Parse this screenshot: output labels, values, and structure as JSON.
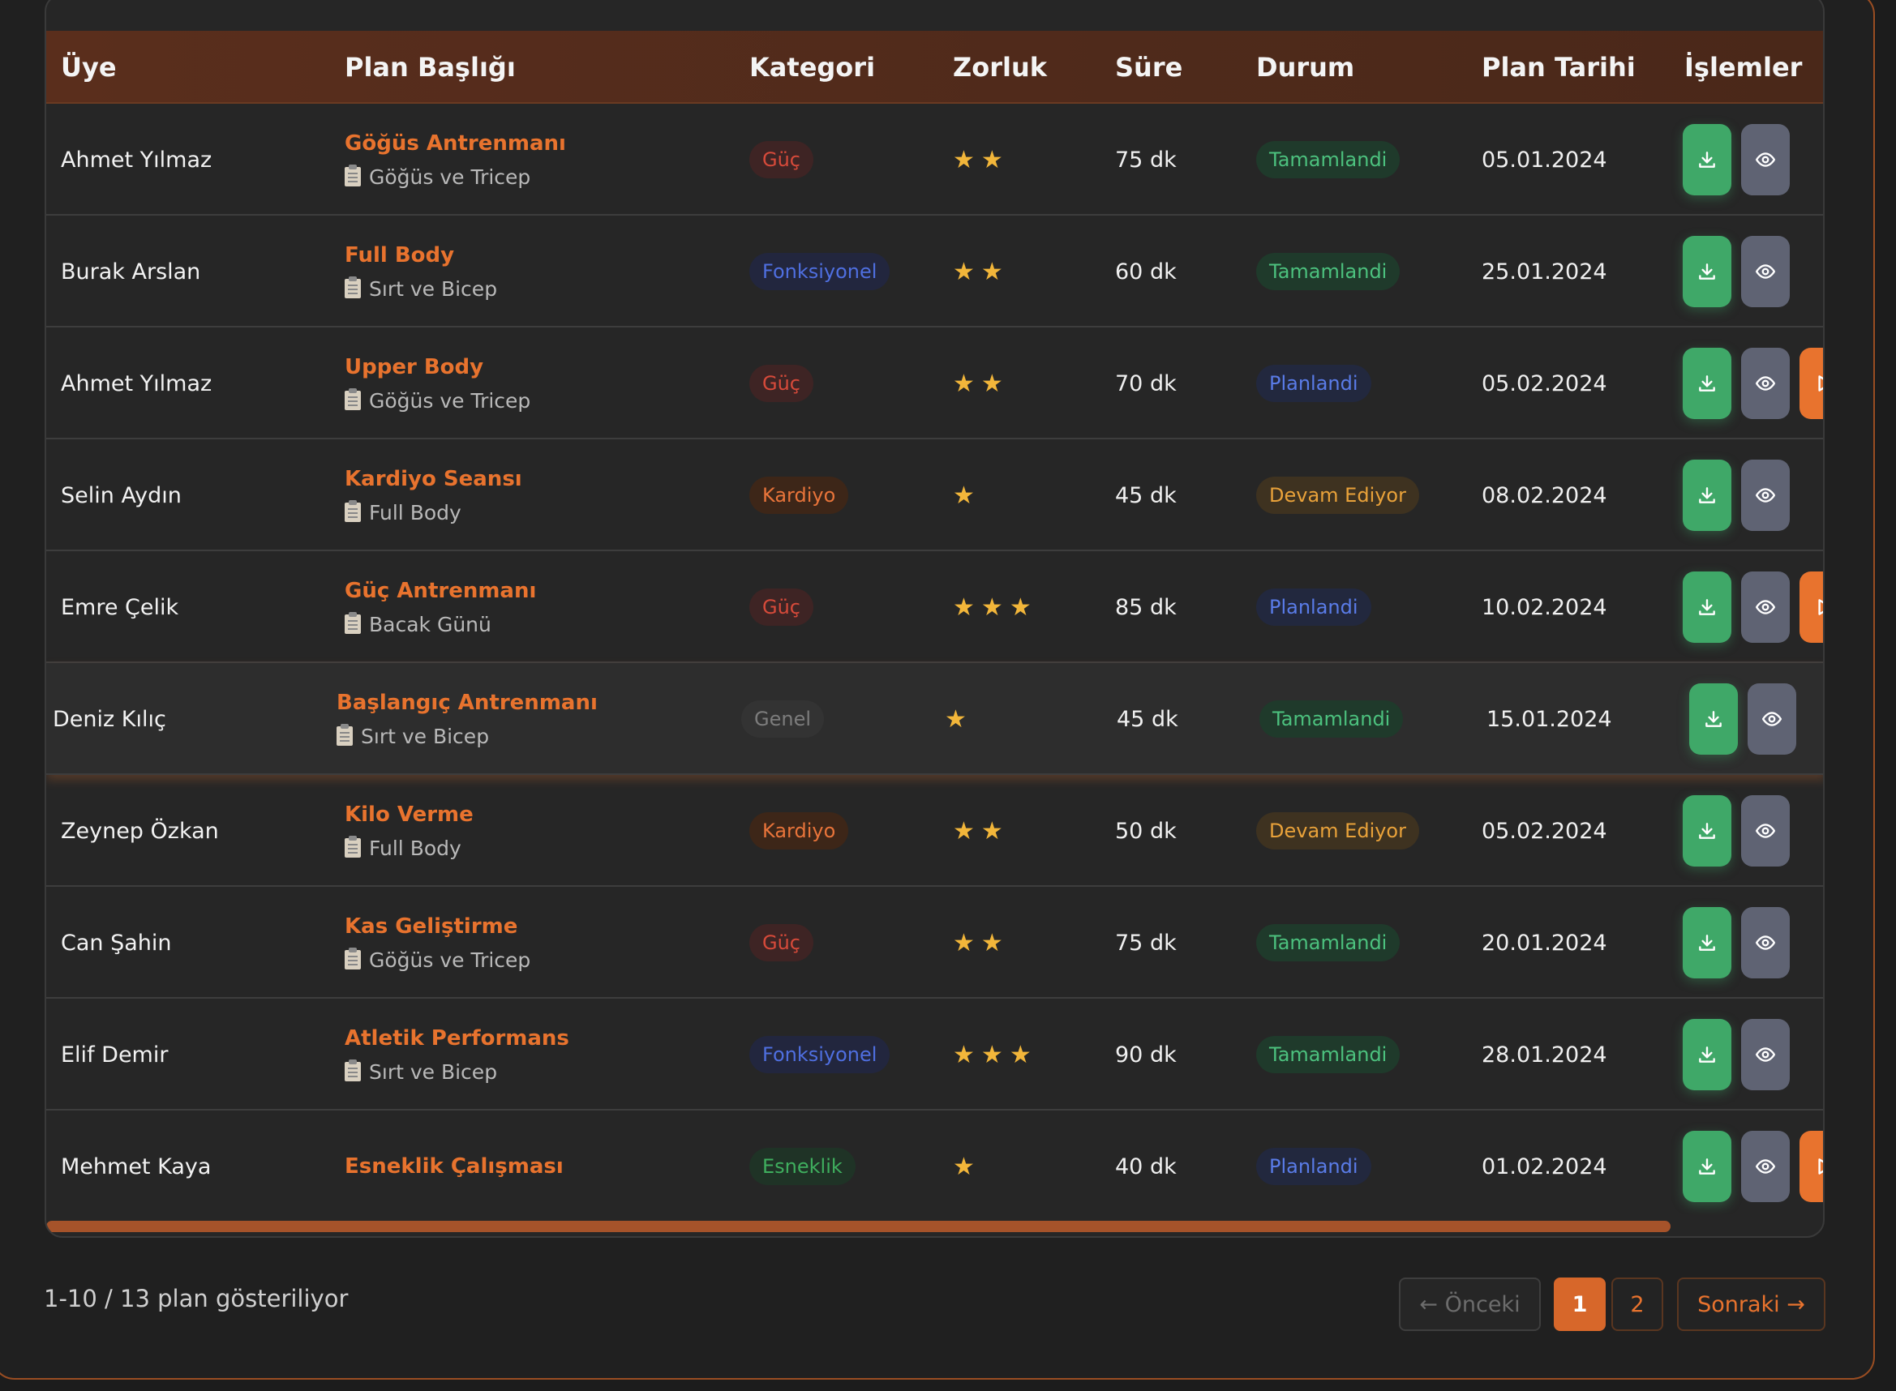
{
  "table": {
    "headers": [
      "Üye",
      "Plan Başlığı",
      "Kategori",
      "Zorluk",
      "Süre",
      "Durum",
      "Plan Tarihi",
      "İşlemler"
    ],
    "rows": [
      {
        "member": "Ahmet Yılmaz",
        "title": "Göğüs Antrenmanı",
        "subtitle": "Göğüs ve Tricep",
        "category": "Güç",
        "category_style": "guc",
        "difficulty": 2,
        "duration": "75 dk",
        "status": "Tamamlandi",
        "status_style": "done",
        "date": "05.01.2024",
        "actions": [
          "download-icon",
          "eye-icon"
        ]
      },
      {
        "member": "Burak Arslan",
        "title": "Full Body",
        "subtitle": "Sırt ve Bicep",
        "category": "Fonksiyonel",
        "category_style": "fonk",
        "difficulty": 2,
        "duration": "60 dk",
        "status": "Tamamlandi",
        "status_style": "done",
        "date": "25.01.2024",
        "actions": [
          "download-icon",
          "eye-icon"
        ]
      },
      {
        "member": "Ahmet Yılmaz",
        "title": "Upper Body",
        "subtitle": "Göğüs ve Tricep",
        "category": "Güç",
        "category_style": "guc",
        "difficulty": 2,
        "duration": "70 dk",
        "status": "Planlandi",
        "status_style": "plan",
        "date": "05.02.2024",
        "actions": [
          "download-icon",
          "eye-icon",
          "play-icon"
        ]
      },
      {
        "member": "Selin Aydın",
        "title": "Kardiyo Seansı",
        "subtitle": "Full Body",
        "category": "Kardiyo",
        "category_style": "kard",
        "difficulty": 1,
        "duration": "45 dk",
        "status": "Devam Ediyor",
        "status_style": "prog",
        "date": "08.02.2024",
        "actions": [
          "download-icon",
          "eye-icon"
        ]
      },
      {
        "member": "Emre Çelik",
        "title": "Güç Antrenmanı",
        "subtitle": "Bacak Günü",
        "category": "Güç",
        "category_style": "guc",
        "difficulty": 3,
        "duration": "85 dk",
        "status": "Planlandi",
        "status_style": "plan",
        "date": "10.02.2024",
        "actions": [
          "download-icon",
          "eye-icon",
          "play-icon"
        ]
      },
      {
        "member": "Deniz Kılıç",
        "title": "Başlangıç Antrenmanı",
        "subtitle": "Sırt ve Bicep",
        "category": "Genel",
        "category_style": "genel",
        "difficulty": 1,
        "duration": "45 dk",
        "status": "Tamamlandi",
        "status_style": "done",
        "date": "15.01.2024",
        "actions": [
          "download-icon",
          "eye-icon"
        ],
        "highlighted": true
      },
      {
        "member": "Zeynep Özkan",
        "title": "Kilo Verme",
        "subtitle": "Full Body",
        "category": "Kardiyo",
        "category_style": "kard",
        "difficulty": 2,
        "duration": "50 dk",
        "status": "Devam Ediyor",
        "status_style": "prog",
        "date": "05.02.2024",
        "actions": [
          "download-icon",
          "eye-icon"
        ]
      },
      {
        "member": "Can Şahin",
        "title": "Kas Geliştirme",
        "subtitle": "Göğüs ve Tricep",
        "category": "Güç",
        "category_style": "guc",
        "difficulty": 2,
        "duration": "75 dk",
        "status": "Tamamlandi",
        "status_style": "done",
        "date": "20.01.2024",
        "actions": [
          "download-icon",
          "eye-icon"
        ]
      },
      {
        "member": "Elif Demir",
        "title": "Atletik Performans",
        "subtitle": "Sırt ve Bicep",
        "category": "Fonksiyonel",
        "category_style": "fonk",
        "difficulty": 3,
        "duration": "90 dk",
        "status": "Tamamlandi",
        "status_style": "done",
        "date": "28.01.2024",
        "actions": [
          "download-icon",
          "eye-icon"
        ]
      },
      {
        "member": "Mehmet Kaya",
        "title": "Esneklik Çalışması",
        "subtitle": "",
        "category": "Esneklik",
        "category_style": "esnek",
        "difficulty": 1,
        "duration": "40 dk",
        "status": "Planlandi",
        "status_style": "plan",
        "date": "01.02.2024",
        "actions": [
          "download-icon",
          "eye-icon",
          "play-icon"
        ]
      }
    ],
    "horizontal_scroll_position": 0.0
  },
  "footer": {
    "summary": "1-10 / 13 plan gösteriliyor",
    "prev_label": "← Önceki",
    "pages": [
      "1",
      "2"
    ],
    "current_page": "1",
    "next_label": "Sonraki →"
  },
  "colors": {
    "accent": "#e8732e",
    "header_bg": "#5a2e1c",
    "success": "#3fa868",
    "star": "#f2b63a"
  }
}
